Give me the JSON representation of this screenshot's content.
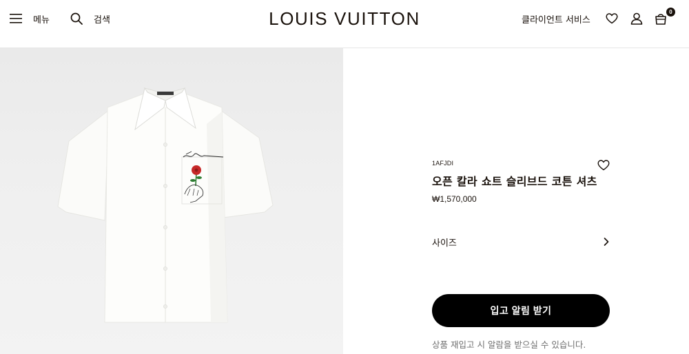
{
  "header": {
    "menu_label": "메뉴",
    "search_label": "검색",
    "logo": "LOUIS VUITTON",
    "client_service_label": "클라이언트 서비스",
    "bag_count": "0"
  },
  "product": {
    "sku": "1AFJDI",
    "name": "오픈 칼라 쇼트 슬리브드 코튼 셔츠",
    "price": "₩1,570,000",
    "size_label": "사이즈",
    "notify_button_label": "입고 알림 받기",
    "notice_text": "상품 재입고 시 알람을 받으실 수 있습니다."
  },
  "icons": {
    "menu": "hamburger-icon",
    "search": "search-icon",
    "wishlist": "heart-icon",
    "account": "user-icon",
    "bag": "bag-icon",
    "size_chevron": "chevron-right-icon"
  },
  "colors": {
    "text": "#19110b",
    "button_bg": "#000000",
    "notice_text": "#6f6f6f",
    "image_bg": "#eeeeee"
  }
}
